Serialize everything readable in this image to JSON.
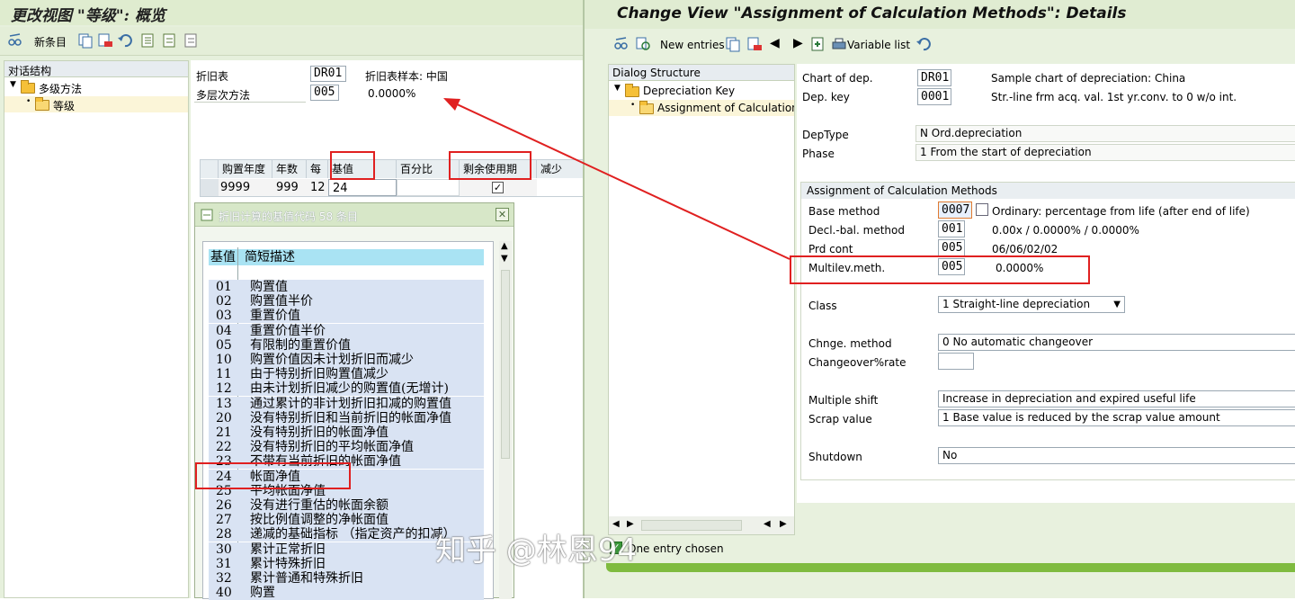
{
  "left_window": {
    "title": "更改视图 \"等级\": 概览",
    "toolbar": {
      "new_entries": "新条目"
    },
    "tree": {
      "header": "对话结构",
      "items": [
        {
          "label": "多级方法"
        },
        {
          "label": "等级"
        }
      ]
    },
    "fields": {
      "chart_label": "折旧表",
      "chart_value": "DR01",
      "chart_sample": "折旧表样本: 中国",
      "multilevel_label": "多层次方法",
      "multilevel_value": "005",
      "multilevel_pct": "0.0000%"
    },
    "table": {
      "headers": [
        "购置年度",
        "年数",
        "每",
        "基值",
        "百分比",
        "剩余使用期",
        "减少"
      ],
      "row": {
        "acq_year": "9999",
        "years": "999",
        "per": "12",
        "base": "24",
        "pct": "",
        "remaining_checked": true,
        "reduce": ""
      }
    },
    "popup": {
      "title": "折旧计算的基值代码 58 条目",
      "col_code": "基值",
      "col_desc": "简短描述",
      "rows": [
        {
          "code": "01",
          "desc": "购置值"
        },
        {
          "code": "02",
          "desc": "购置值半价"
        },
        {
          "code": "03",
          "desc": "重置价值"
        },
        {
          "code": "04",
          "desc": "重置价值半价"
        },
        {
          "code": "05",
          "desc": "有限制的重置价值"
        },
        {
          "code": "10",
          "desc": "购置价值因未计划折旧而减少"
        },
        {
          "code": "11",
          "desc": "由于特别折旧购置值减少"
        },
        {
          "code": "12",
          "desc": "由未计划折旧减少的购置值(无增计)"
        },
        {
          "code": "13",
          "desc": "通过累计的非计划折旧扣减的购置值"
        },
        {
          "code": "20",
          "desc": "没有特别折旧和当前折旧的帐面净值"
        },
        {
          "code": "21",
          "desc": "没有特别折旧的帐面净值"
        },
        {
          "code": "22",
          "desc": "没有特别折旧的平均帐面净值"
        },
        {
          "code": "23",
          "desc": "不带有当前折旧的帐面净值"
        },
        {
          "code": "24",
          "desc": "帐面净值"
        },
        {
          "code": "25",
          "desc": "平均帐面净值"
        },
        {
          "code": "26",
          "desc": "没有进行重估的帐面余额"
        },
        {
          "code": "27",
          "desc": "按比例值调整的净帐面值"
        },
        {
          "code": "28",
          "desc": "递减的基础指标 （指定资产的扣减）"
        },
        {
          "code": "30",
          "desc": "累计正常折旧"
        },
        {
          "code": "31",
          "desc": "累计特殊折旧"
        },
        {
          "code": "32",
          "desc": "累计普通和特殊折旧"
        },
        {
          "code": "40",
          "desc": "购置"
        }
      ]
    }
  },
  "right_window": {
    "title": "Change View \"Assignment of Calculation Methods\": Details",
    "toolbar": {
      "new_entries": "New entries",
      "variable_list": "Variable list"
    },
    "tree": {
      "header": "Dialog Structure",
      "items": [
        {
          "label": "Depreciation Key"
        },
        {
          "label": "Assignment of Calculation Methods"
        }
      ]
    },
    "fields": {
      "chart_label": "Chart of dep.",
      "chart_value": "DR01",
      "chart_desc": "Sample chart of depreciation: China",
      "depkey_label": "Dep. key",
      "depkey_value": "0001",
      "depkey_desc": "Str.-line frm acq. val. 1st yr.conv. to 0 w/o int.",
      "deptype_label": "DepType",
      "deptype_value": "N Ord.depreciation",
      "phase_label": "Phase",
      "phase_value": "1 From the start of depreciation"
    },
    "group": {
      "title": "Assignment of Calculation Methods",
      "base_label": "Base method",
      "base_value": "0007",
      "base_desc": "Ordinary: percentage from life (after end of life)",
      "decl_label": "Decl.-bal. method",
      "decl_value": "001",
      "decl_desc": "0.00x / 0.0000% / 0.0000%",
      "prd_label": "Prd cont",
      "prd_value": "005",
      "prd_desc": "06/06/02/02",
      "multi_label": "Multilev.meth.",
      "multi_value": "005",
      "multi_desc": "0.0000%",
      "class_label": "Class",
      "class_value": "1 Straight-line depreciation",
      "chng_label": "Chnge. method",
      "chng_value": "0 No automatic changeover",
      "rate_label": "Changeover%rate",
      "rate_value": "",
      "shift_label": "Multiple shift",
      "shift_value": "Increase in depreciation and expired useful life",
      "scrap_label": "Scrap value",
      "scrap_value": "1 Base value is reduced by the scrap value amount",
      "shutdown_label": "Shutdown",
      "shutdown_value": "No"
    },
    "status": "One entry chosen"
  },
  "watermark": "知乎 @林恩94",
  "colors": {
    "annotation_red": "#e02020",
    "sap_green": "#7fbb3f",
    "list_row_blue": "#d9e3f3"
  }
}
